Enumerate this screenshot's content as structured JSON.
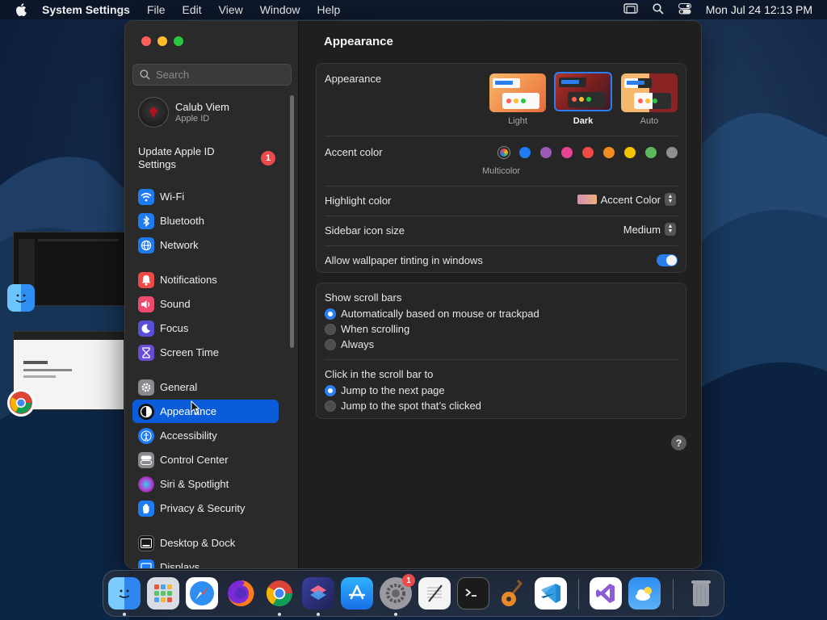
{
  "menubar": {
    "app_name": "System Settings",
    "menus": [
      "File",
      "Edit",
      "View",
      "Window",
      "Help"
    ],
    "clock": "Mon Jul 24  12:13 PM"
  },
  "sidebar": {
    "search_placeholder": "Search",
    "profile": {
      "name": "Calub Viem",
      "subtitle": "Apple ID"
    },
    "update": {
      "label": "Update Apple ID Settings",
      "badge": "1"
    },
    "items": [
      {
        "label": "Wi-Fi",
        "icon": "wifi-icon",
        "color": "#1f7bf2"
      },
      {
        "label": "Bluetooth",
        "icon": "bluetooth-icon",
        "color": "#1f7bf2"
      },
      {
        "label": "Network",
        "icon": "globe-icon",
        "color": "#1f7bf2"
      },
      {
        "label": "Notifications",
        "icon": "bell-icon",
        "color": "#ee4a46"
      },
      {
        "label": "Sound",
        "icon": "speaker-icon",
        "color": "#ee4a6e"
      },
      {
        "label": "Focus",
        "icon": "moon-icon",
        "color": "#5a4fd8"
      },
      {
        "label": "Screen Time",
        "icon": "hourglass-icon",
        "color": "#6a4bd6"
      },
      {
        "label": "General",
        "icon": "gear-icon",
        "color": "#8a8a8e"
      },
      {
        "label": "Appearance",
        "icon": "appearance-icon",
        "color": "#1a1a1a"
      },
      {
        "label": "Accessibility",
        "icon": "accessibility-icon",
        "color": "#1f7bf2"
      },
      {
        "label": "Control Center",
        "icon": "control-center-icon",
        "color": "#8a8a8e"
      },
      {
        "label": "Siri & Spotlight",
        "icon": "siri-icon",
        "color": "#b23bd4"
      },
      {
        "label": "Privacy & Security",
        "icon": "hand-icon",
        "color": "#1f7bf2"
      },
      {
        "label": "Desktop & Dock",
        "icon": "dock-icon",
        "color": "#1a1a1a"
      },
      {
        "label": "Displays",
        "icon": "display-icon",
        "color": "#1f7bf2"
      }
    ],
    "selected": "Appearance"
  },
  "content": {
    "title": "Appearance",
    "appearance": {
      "label": "Appearance",
      "options": [
        "Light",
        "Dark",
        "Auto"
      ],
      "selected": "Dark"
    },
    "accent": {
      "label": "Accent color",
      "selected_name": "Multicolor",
      "colors": [
        "#1f7bf2",
        "#9b59b6",
        "#e84393",
        "#ee4a46",
        "#f28c1f",
        "#f5c400",
        "#5cb85c",
        "#8e8e8e"
      ]
    },
    "highlight": {
      "label": "Highlight color",
      "value": "Accent Color"
    },
    "icon_size": {
      "label": "Sidebar icon size",
      "value": "Medium"
    },
    "tinting": {
      "label": "Allow wallpaper tinting in windows",
      "enabled": true
    },
    "scrollbars": {
      "label": "Show scroll bars",
      "options": [
        "Automatically based on mouse or trackpad",
        "When scrolling",
        "Always"
      ],
      "selected": 0
    },
    "click_scroll": {
      "label": "Click in the scroll bar to",
      "options": [
        "Jump to the next page",
        "Jump to the spot that’s clicked"
      ],
      "selected": 0
    },
    "help": "?"
  },
  "dock": {
    "apps": [
      "finder-icon",
      "launchpad-icon",
      "safari-icon",
      "firefox-icon",
      "chrome-icon",
      "shortcuts-icon",
      "app-store-icon",
      "system-settings-icon",
      "textedit-icon",
      "terminal-icon",
      "garageband-icon",
      "vscode-icon",
      "visual-studio-icon",
      "weather-icon",
      "trash-icon"
    ],
    "settings_badge": "1"
  }
}
